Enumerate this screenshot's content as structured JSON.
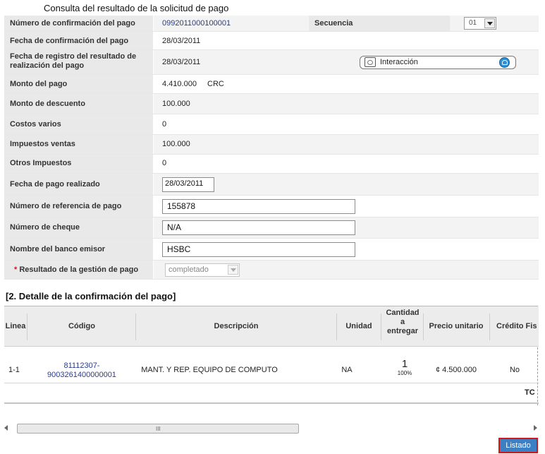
{
  "page_title": "Consulta del resultado de la solicitud de pago",
  "form": {
    "confirmacion_label": "Número de confirmación del pago",
    "confirmacion_value": "0992011000100001",
    "secuencia_label": "Secuencia",
    "secuencia_value": "01",
    "fecha_confirmacion_label": "Fecha de confirmación del pago",
    "fecha_confirmacion_value": "28/03/2011",
    "fecha_registro_label_line1": "Fecha de registro del resultado de",
    "fecha_registro_label_line2": "realización del pago",
    "fecha_registro_value": "28/03/2011",
    "interaccion_label": "Interacción",
    "monto_label": "Monto del pago",
    "monto_value": "4.410.000",
    "monto_currency": "CRC",
    "descuento_label": "Monto de descuento",
    "descuento_value": "100.000",
    "costos_label": "Costos varios",
    "costos_value": "0",
    "impuestos_label": "Impuestos ventas",
    "impuestos_value": "100.000",
    "otros_label": "Otros Impuestos",
    "otros_value": "0",
    "fecha_pago_label": "Fecha de pago realizado",
    "fecha_pago_value": "28/03/2011",
    "referencia_label": "Número de referencia de pago",
    "referencia_value": "155878",
    "cheque_label": "Número de cheque",
    "cheque_value": "N/A",
    "banco_label": "Nombre del banco emisor",
    "banco_value": "HSBC",
    "resultado_required": "*",
    "resultado_label": "Resultado de la gestión de pago",
    "resultado_value": "completado"
  },
  "section2": {
    "title": "[2. Detalle de la confirmación del pago]",
    "headers": {
      "linea": "Linea",
      "codigo": "Código",
      "descripcion": "Descripción",
      "unidad": "Unidad",
      "cantidad_1": "Cantidad",
      "cantidad_2": "a",
      "cantidad_3": "entregar",
      "precio": "Precio unitario",
      "credito": "Crédito Fis"
    },
    "row": {
      "linea": "1-1",
      "codigo_1": "81112307-",
      "codigo_2": "9003261400000001",
      "descripcion": "MANT. Y REP. EQUIPO DE COMPUTO",
      "unidad": "NA",
      "cantidad": "1",
      "cantidad_pct": "100%",
      "precio": "¢ 4.500.000",
      "credito": "No"
    },
    "total_partial": "TC"
  },
  "scroll_grip": "III",
  "listado_label": "Listado"
}
